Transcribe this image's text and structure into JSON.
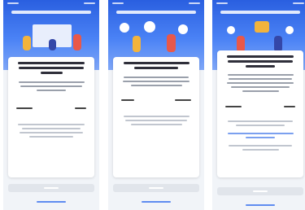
{
  "colors": {
    "hero_top": "#2a5fe0",
    "hero_bottom": "#7fa7f8",
    "card": "#ffffff",
    "heading_text": "#2f2f3a",
    "body_text": "#9aa0ab",
    "link": "#5f8cf0",
    "button_disabled": "#e1e5eb"
  },
  "screens": [
    {
      "illustration": "people-around-display-illustration",
      "heading_lines": 3,
      "body_lines": 3,
      "has_options": true,
      "note_lines": 4,
      "link_lines": 0
    },
    {
      "illustration": "people-with-speech-bubbles-illustration",
      "heading_lines": 2,
      "body_lines": 3,
      "has_options": true,
      "note_lines": 3,
      "link_lines": 0
    },
    {
      "illustration": "people-celebrating-illustration",
      "heading_lines": 3,
      "body_lines": 5,
      "has_options": true,
      "note_lines": 2,
      "link_lines": 2
    }
  ]
}
